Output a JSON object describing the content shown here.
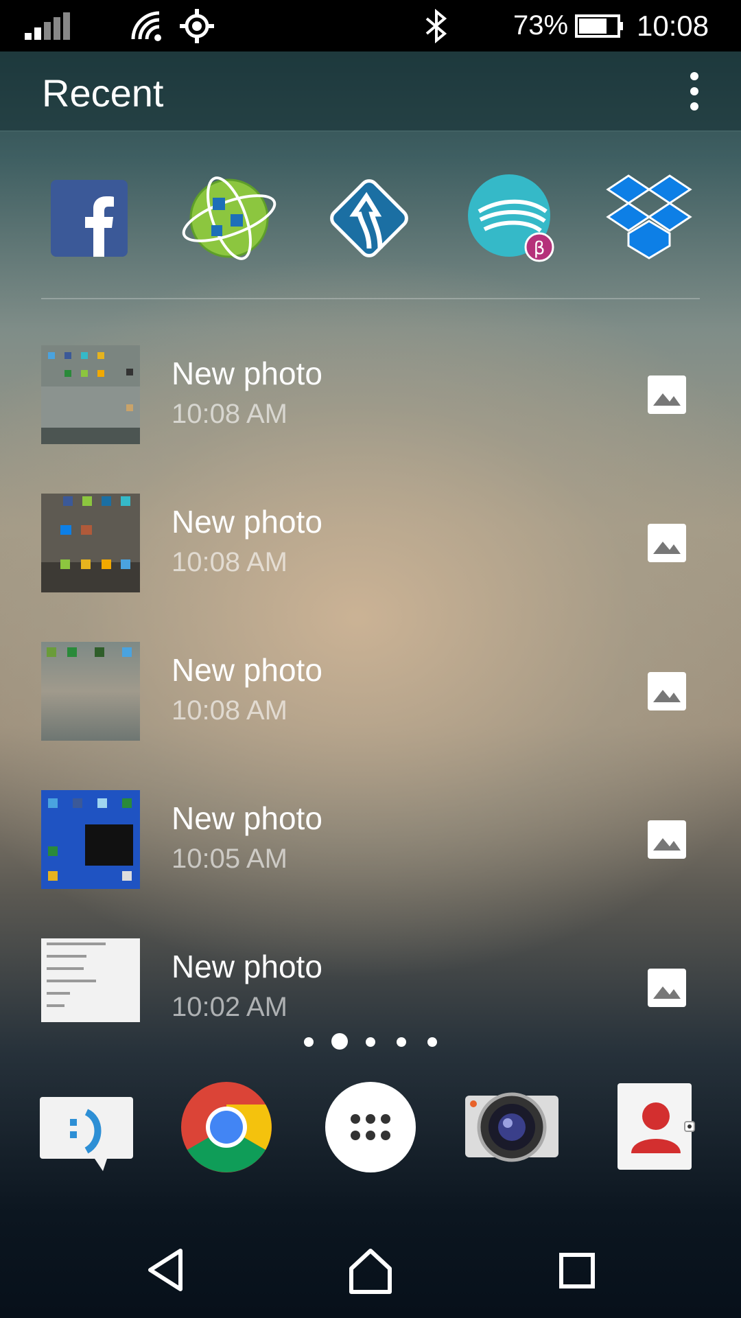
{
  "status_bar": {
    "battery_percent": "73%",
    "time": "10:08",
    "icons": [
      "signal-icon",
      "wifi-icon",
      "location-icon",
      "bluetooth-icon",
      "battery-icon"
    ]
  },
  "header": {
    "title": "Recent",
    "menu_icon": "overflow-menu-icon"
  },
  "recent_apps": [
    {
      "name": "facebook-app-icon",
      "color": "#3b5998"
    },
    {
      "name": "network-app-icon",
      "color": "#7cbf3a"
    },
    {
      "name": "navigation-app-icon",
      "color": "#1b6fa3"
    },
    {
      "name": "swiftkey-beta-app-icon",
      "color": "#35b9c8",
      "badge": "β"
    },
    {
      "name": "dropbox-app-icon",
      "color": "#0d7fe6"
    }
  ],
  "list": [
    {
      "title": "New photo",
      "time": "10:08 AM"
    },
    {
      "title": "New photo",
      "time": "10:08 AM"
    },
    {
      "title": "New photo",
      "time": "10:08 AM"
    },
    {
      "title": "New photo",
      "time": "10:05 AM"
    },
    {
      "title": "New photo",
      "time": "10:02 AM"
    }
  ],
  "page_indicator": {
    "count": 5,
    "active_index": 1
  },
  "dock": [
    {
      "name": "messaging-app-icon"
    },
    {
      "name": "chrome-app-icon"
    },
    {
      "name": "app-drawer-icon"
    },
    {
      "name": "camera-app-icon"
    },
    {
      "name": "contacts-app-icon"
    }
  ],
  "nav_bar": [
    "back-icon",
    "home-icon",
    "recents-icon"
  ]
}
